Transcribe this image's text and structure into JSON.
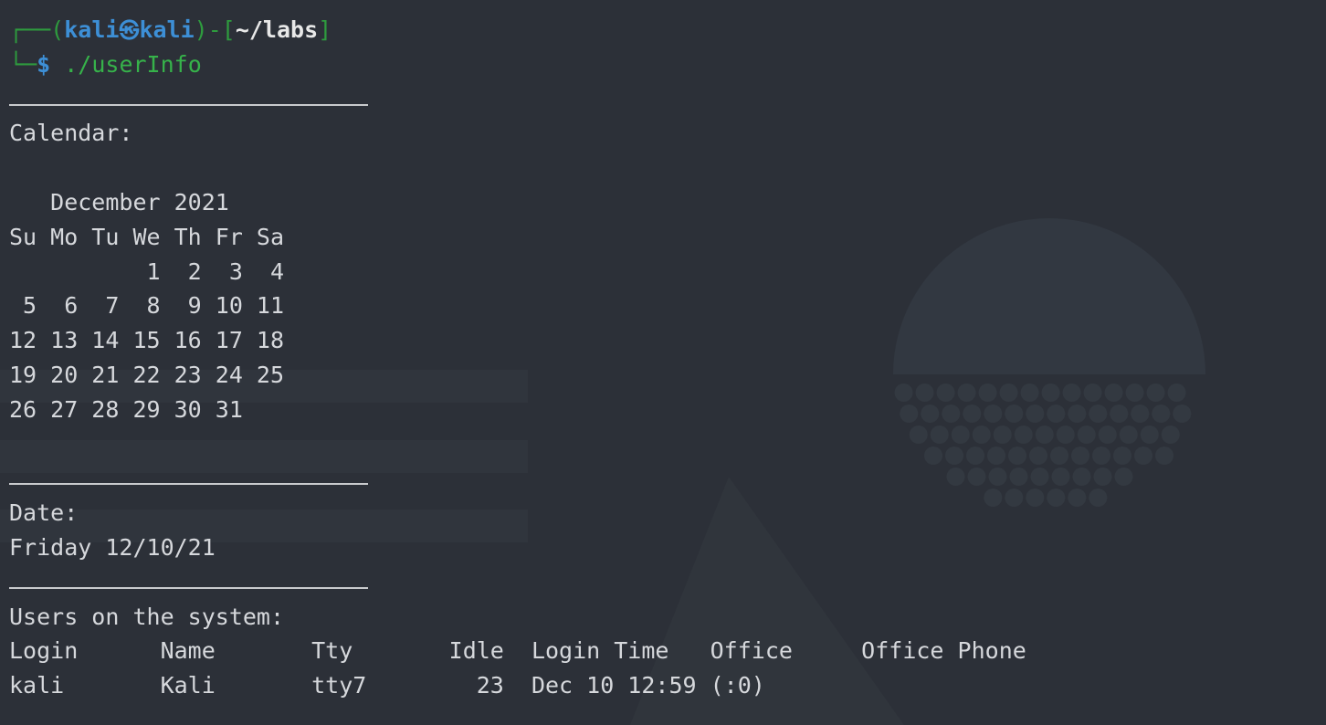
{
  "prompt": {
    "user": "kali",
    "at_symbol": "㉿",
    "host": "kali",
    "path": "~/labs",
    "symbol": "$",
    "command": "./userInfo"
  },
  "calendar": {
    "heading": "Calendar:",
    "month_title": "December 2021",
    "weekday_row": "Su Mo Tu We Th Fr Sa",
    "weeks": [
      "          1  2  3  4",
      " 5  6  7  8  9 10 11",
      "12 13 14 15 16 17 18",
      "19 20 21 22 23 24 25",
      "26 27 28 29 30 31"
    ]
  },
  "date": {
    "heading": "Date:",
    "value": "Friday 12/10/21"
  },
  "users": {
    "heading": "Users on the system:",
    "header_row": "Login      Name       Tty       Idle  Login Time   Office     Office Phone",
    "rows": [
      "kali       Kali       tty7        23  Dec 10 12:59 (:0)"
    ]
  },
  "colors": {
    "background": "#2c3038",
    "text": "#d6d8dc",
    "prompt_frame": "#2e9b3e",
    "prompt_user": "#3d8fd6",
    "command": "#36b24a"
  }
}
